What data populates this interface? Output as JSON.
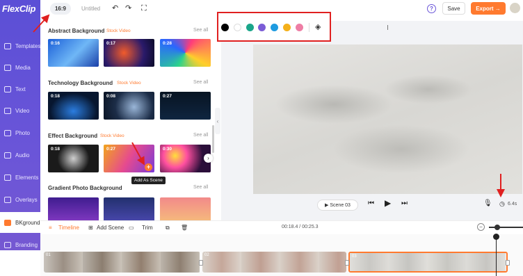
{
  "app": {
    "logo": "FlexClip",
    "title": "Untitled",
    "aspect_ratio": "16:9"
  },
  "toolbar": {
    "help": "?",
    "save": "Save",
    "export": "Export →"
  },
  "sidebar": {
    "items": [
      {
        "label": "Templates",
        "icon": "templates-icon"
      },
      {
        "label": "Media",
        "icon": "media-icon"
      },
      {
        "label": "Text",
        "icon": "text-icon"
      },
      {
        "label": "Video",
        "icon": "video-icon"
      },
      {
        "label": "Photo",
        "icon": "photo-icon"
      },
      {
        "label": "Audio",
        "icon": "audio-icon"
      },
      {
        "label": "Elements",
        "icon": "elements-icon"
      },
      {
        "label": "Overlays",
        "icon": "overlays-icon"
      },
      {
        "label": "BKground",
        "icon": "background-icon",
        "active": true
      },
      {
        "label": "Branding",
        "icon": "branding-icon"
      }
    ]
  },
  "library": {
    "see_all": "See all",
    "sections": [
      {
        "title": "Abstract Background",
        "tag": "Stock Video",
        "durations": [
          "0:16",
          "0:17",
          "0:28"
        ]
      },
      {
        "title": "Technology Background",
        "tag": "Stock Video",
        "durations": [
          "0:18",
          "0:08",
          "0:27"
        ]
      },
      {
        "title": "Effect Background",
        "tag": "Stock Video",
        "durations": [
          "0:18",
          "0:27",
          "0:30"
        ]
      },
      {
        "title": "Gradient Photo Background",
        "tag": "",
        "durations": [
          "",
          "",
          ""
        ]
      }
    ],
    "add_plus": "+",
    "tooltip": "Add As Scene"
  },
  "color_picker": {
    "swatches": [
      "#000000",
      "#ffffff",
      "#1aa68a",
      "#7b5cd6",
      "#1e9be0",
      "#f4b01a",
      "#ee7ea5"
    ],
    "fill_icon": "paint-bucket-icon"
  },
  "player": {
    "scene_label": "▶ Scene 03",
    "duration": "6.4s"
  },
  "timeline": {
    "tab_timeline": "Timeline",
    "add_scene": "Add Scene",
    "trim": "Trim",
    "time": "00:18.4 / 00:25.3",
    "clip_numbers": [
      "01",
      "02",
      "03"
    ]
  },
  "colors": {
    "accent": "#ff7a2f",
    "brand": "#6a55d8",
    "annotation": "#e02020"
  }
}
